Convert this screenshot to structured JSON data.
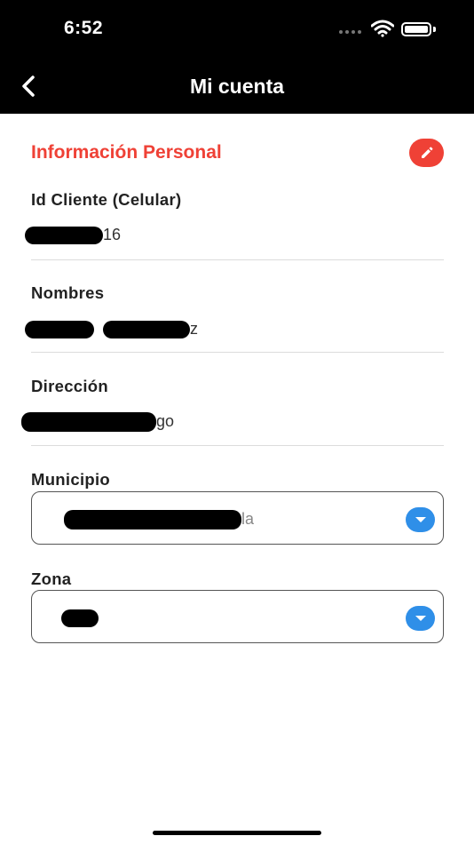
{
  "status_bar": {
    "time": "6:52"
  },
  "header": {
    "title": "Mi cuenta",
    "back_icon": "chevron-left-icon"
  },
  "section": {
    "title": "Información Personal",
    "edit_icon": "pencil-icon"
  },
  "fields": {
    "id_cliente": {
      "label": "Id Cliente (Celular)",
      "value_suffix": "16"
    },
    "nombres": {
      "label": "Nombres",
      "value_suffix": "z"
    },
    "direccion": {
      "label": "Dirección",
      "value_suffix": "go"
    }
  },
  "selects": {
    "municipio": {
      "label": "Municipio",
      "value_suffix": "la",
      "arrow_icon": "chevron-down-icon"
    },
    "zona": {
      "label": "Zona",
      "value_suffix": "",
      "arrow_icon": "chevron-down-icon"
    }
  },
  "colors": {
    "accent": "#ef4136",
    "dropdown": "#2f8fe8",
    "header_bg": "#000000"
  }
}
